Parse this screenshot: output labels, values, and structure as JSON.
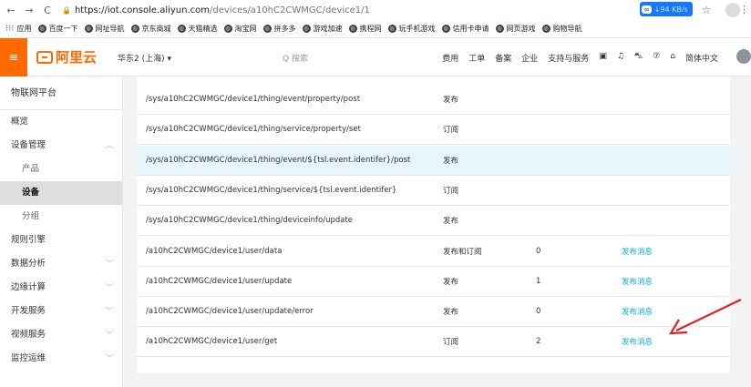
{
  "browser": {
    "back": "←",
    "forward": "→",
    "reload": "C",
    "url_host": "https://iot.console.aliyun.com",
    "url_path": "/devices/a10hC2CWMGC/device1/1",
    "ext_badge": "↓94 KB/s",
    "ext_infinity": "∞"
  },
  "bookmarks": [
    {
      "label": "应用",
      "icon": "apps-grid-icon"
    },
    {
      "label": "百度一下",
      "icon": "globe-icon"
    },
    {
      "label": "网址导航",
      "icon": "globe-icon"
    },
    {
      "label": "京东商城",
      "icon": "globe-icon"
    },
    {
      "label": "天猫精选",
      "icon": "globe-icon"
    },
    {
      "label": "淘宝网",
      "icon": "globe-icon"
    },
    {
      "label": "拼多多",
      "icon": "globe-icon"
    },
    {
      "label": "游戏加速",
      "icon": "globe-icon"
    },
    {
      "label": "携程网",
      "icon": "globe-icon"
    },
    {
      "label": "玩手机游戏",
      "icon": "globe-icon"
    },
    {
      "label": "信用卡申请",
      "icon": "globe-icon"
    },
    {
      "label": "网页游戏",
      "icon": "globe-icon"
    },
    {
      "label": "购物导航",
      "icon": "globe-icon"
    }
  ],
  "topnav": {
    "logo": "阿里云",
    "region": "华东2 (上海) ▾",
    "search": "Q 搜索",
    "links": [
      "费用",
      "工单",
      "备案",
      "企业",
      "支持与服务",
      "▣",
      "♫",
      "⛍",
      "⑦",
      "⌂",
      "简体中文"
    ]
  },
  "sidebar": {
    "title": "物联网平台",
    "items": [
      {
        "label": "概览",
        "sub": false,
        "chev": ""
      },
      {
        "label": "设备管理",
        "sub": false,
        "chev": "︿"
      },
      {
        "label": "产品",
        "sub": true,
        "chev": ""
      },
      {
        "label": "设备",
        "sub": true,
        "chev": "",
        "active": true
      },
      {
        "label": "分组",
        "sub": true,
        "chev": ""
      },
      {
        "label": "规则引擎",
        "sub": false,
        "chev": ""
      },
      {
        "label": "数据分析",
        "sub": false,
        "chev": "﹀"
      },
      {
        "label": "边缘计算",
        "sub": false,
        "chev": "﹀"
      },
      {
        "label": "开发服务",
        "sub": false,
        "chev": "﹀"
      },
      {
        "label": "视频服务",
        "sub": false,
        "chev": "﹀"
      },
      {
        "label": "监控运维",
        "sub": false,
        "chev": "﹀"
      }
    ]
  },
  "table": {
    "rows": [
      {
        "topic": "/sys/a10hC2CWMGC/device1/thing/event/property/post",
        "perm": "发布",
        "count": "",
        "action": ""
      },
      {
        "topic": "/sys/a10hC2CWMGC/device1/thing/service/property/set",
        "perm": "订阅",
        "count": "",
        "action": ""
      },
      {
        "topic": "/sys/a10hC2CWMGC/device1/thing/event/${tsl.event.identifer}/post",
        "perm": "发布",
        "count": "",
        "action": "",
        "highlight": true
      },
      {
        "topic": "/sys/a10hC2CWMGC/device1/thing/service/${tsl.event.identifer}",
        "perm": "订阅",
        "count": "",
        "action": ""
      },
      {
        "topic": "/sys/a10hC2CWMGC/device1/thing/deviceinfo/update",
        "perm": "发布",
        "count": "",
        "action": ""
      },
      {
        "topic": "/a10hC2CWMGC/device1/user/data",
        "perm": "发布和订阅",
        "count": "0",
        "action": "发布消息"
      },
      {
        "topic": "/a10hC2CWMGC/device1/user/update",
        "perm": "发布",
        "count": "1",
        "action": "发布消息"
      },
      {
        "topic": "/a10hC2CWMGC/device1/user/update/error",
        "perm": "发布",
        "count": "0",
        "action": "发布消息"
      },
      {
        "topic": "/a10hC2CWMGC/device1/user/get",
        "perm": "订阅",
        "count": "2",
        "action": "发布消息"
      }
    ]
  },
  "colors": {
    "brand": "#ff6a00",
    "link": "#0ab0d7",
    "highlight_row": "#e7f6fa",
    "annotation_arrow": "#e02020"
  }
}
